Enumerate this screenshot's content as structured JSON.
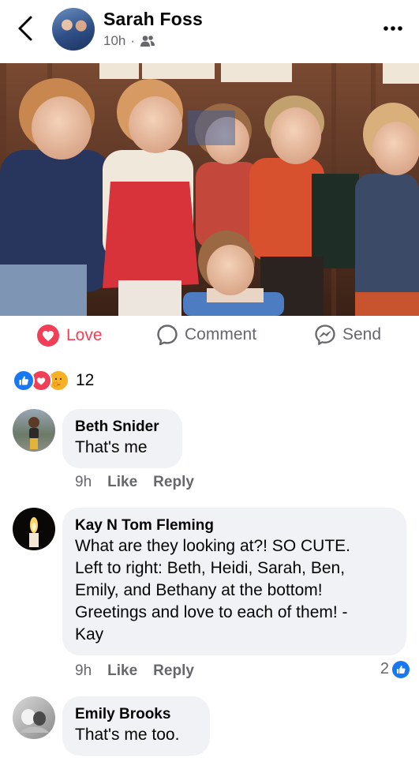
{
  "post": {
    "poster_name": "Sarah Foss",
    "time": "10h",
    "separator": "·",
    "audience_icon": "friends-icon"
  },
  "actions": {
    "love": "Love",
    "comment": "Comment",
    "send": "Send"
  },
  "reactions": {
    "types": [
      "like",
      "love",
      "care"
    ],
    "count": "12"
  },
  "comments": [
    {
      "name": "Beth Snider",
      "text": "That's me",
      "time": "9h",
      "like": "Like",
      "reply": "Reply"
    },
    {
      "name": "Kay N Tom Fleming",
      "text_lines": [
        "What are they looking at?! SO CUTE.",
        "Left to right: Beth, Heidi, Sarah, Ben,",
        "Emily, and Bethany at the bottom!",
        "Greetings and love to each of them! -",
        "Kay"
      ],
      "time": "9h",
      "like": "Like",
      "reply": "Reply",
      "reaction_count": "2"
    },
    {
      "name": "Emily Brooks",
      "text": "That's me too."
    }
  ],
  "colors": {
    "love": "#f33e58",
    "like": "#1877f2",
    "muted": "#65676b",
    "bubble": "#f0f2f5"
  }
}
